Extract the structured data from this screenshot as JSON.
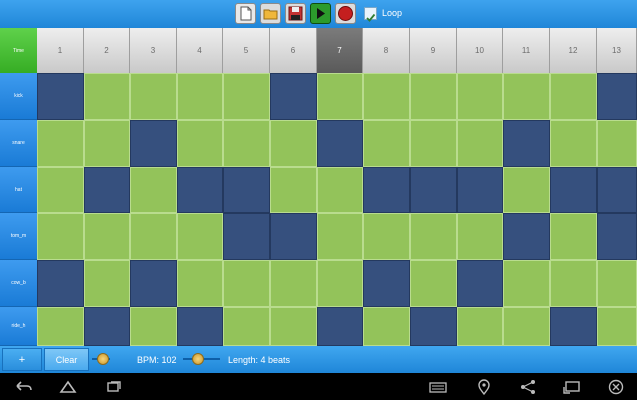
{
  "toolbar": {
    "buttons": [
      {
        "name": "new-file",
        "color": "#f2f2f2"
      },
      {
        "name": "open-folder",
        "color": "#f0b73a"
      },
      {
        "name": "save",
        "color": "#c23333"
      },
      {
        "name": "play",
        "color": "#2c9b2c"
      },
      {
        "name": "record",
        "color": "#c41f1f"
      }
    ],
    "loop_checked": true,
    "loop_label": "Loop"
  },
  "grid": {
    "corner_label": "Time",
    "columns": [
      "1",
      "2",
      "3",
      "4",
      "5",
      "6",
      "7",
      "8",
      "9",
      "10",
      "11",
      "12",
      "13"
    ],
    "active_column": 7,
    "rows": [
      {
        "label": "kick",
        "steps": [
          1,
          0,
          0,
          0,
          0,
          1,
          0,
          0,
          0,
          0,
          0,
          0,
          1
        ]
      },
      {
        "label": "snare",
        "steps": [
          0,
          0,
          1,
          0,
          0,
          0,
          1,
          0,
          0,
          0,
          1,
          0,
          0
        ]
      },
      {
        "label": "hat",
        "steps": [
          0,
          1,
          0,
          1,
          1,
          0,
          0,
          1,
          1,
          1,
          0,
          1,
          1
        ]
      },
      {
        "label": "tom_m",
        "steps": [
          0,
          0,
          0,
          0,
          1,
          1,
          0,
          0,
          0,
          0,
          1,
          0,
          1
        ]
      },
      {
        "label": "cow_b",
        "steps": [
          1,
          0,
          1,
          0,
          0,
          0,
          0,
          1,
          0,
          1,
          0,
          0,
          0
        ]
      },
      {
        "label": "ride_h",
        "steps": [
          0,
          1,
          0,
          1,
          0,
          0,
          1,
          0,
          1,
          0,
          0,
          1,
          0
        ]
      }
    ]
  },
  "bottombar": {
    "add_label": "+",
    "clear_label": "Clear",
    "bpm_text": "BPM: 102",
    "length_text": "Length: 4 beats"
  },
  "colors": {
    "step_on": "#36507e",
    "step_off": "#93c35a",
    "accent": "#2a92e4"
  }
}
